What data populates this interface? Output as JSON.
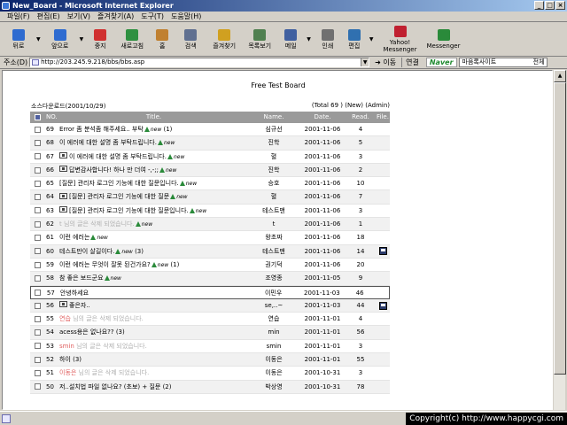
{
  "window": {
    "title": "New_Board - Microsoft Internet Explorer"
  },
  "menu": [
    "파일(F)",
    "편집(E)",
    "보기(V)",
    "즐겨찾기(A)",
    "도구(T)",
    "도움말(H)"
  ],
  "toolbar": [
    {
      "label": "뒤로",
      "icon": "back-arrow-icon",
      "color": "#2e6bd0",
      "drop": true
    },
    {
      "label": "앞으로",
      "icon": "forward-arrow-icon",
      "color": "#2e6bd0",
      "drop": true
    },
    {
      "label": "중지",
      "icon": "stop-icon",
      "color": "#d03030",
      "drop": false
    },
    {
      "label": "새로고침",
      "icon": "refresh-icon",
      "color": "#2e9040",
      "drop": false
    },
    {
      "label": "홈",
      "icon": "home-icon",
      "color": "#c08030",
      "drop": false
    },
    {
      "label": "검색",
      "icon": "search-icon",
      "color": "#607090",
      "drop": false
    },
    {
      "label": "즐겨찾기",
      "icon": "favorites-icon",
      "color": "#d0a020",
      "drop": false
    },
    {
      "label": "목록보기",
      "icon": "history-icon",
      "color": "#508050",
      "drop": false
    },
    {
      "label": "메일",
      "icon": "mail-icon",
      "color": "#4060a0",
      "drop": true
    },
    {
      "label": "인쇄",
      "icon": "print-icon",
      "color": "#707070",
      "drop": false
    },
    {
      "label": "편집",
      "icon": "edit-icon",
      "color": "#3070b0",
      "drop": true
    },
    {
      "label": "Yahoo! Messenger",
      "icon": "yahoo-messenger-icon",
      "color": "#c02030",
      "drop": false
    },
    {
      "label": "Messenger",
      "icon": "messenger-icon",
      "color": "#2a8a3a",
      "drop": false
    }
  ],
  "address": {
    "label": "주소(D)",
    "url": "http://203.245.9.218/bbs/bbs.asp",
    "go": "이동",
    "links": "연결",
    "naver": "Naver",
    "naver_text": "마음록사이트",
    "naver_side": "전체"
  },
  "board": {
    "title": "Free Test Board",
    "subtitle": "소스다운로드(2001/10/29)",
    "summary": "(Total 69 ) (New) (Admin)",
    "headers": {
      "no": "NO.",
      "title": "Title.",
      "name": "Name.",
      "date": "Date.",
      "read": "Read.",
      "file": "File."
    },
    "rows": [
      {
        "no": "69",
        "title": "Error 좀 분석좀 해주세요.. 부탁",
        "isnew": true,
        "count": "(1)",
        "name": "심규선",
        "date": "2001-11-06",
        "read": "4"
      },
      {
        "no": "68",
        "title": "이 에러에 대한 설명 좀 부탁드립니다.",
        "isnew": true,
        "name": "진학",
        "date": "2001-11-06",
        "read": "5"
      },
      {
        "no": "67",
        "title": "이 에러에 대한 설명 좀 부탁드립니다.",
        "reply": true,
        "isnew": true,
        "name": "혈",
        "date": "2001-11-06",
        "read": "3"
      },
      {
        "no": "66",
        "title": "답변감사합니다! 하나 만 더여 -,-;;",
        "reply": true,
        "isnew": true,
        "name": "진학",
        "date": "2001-11-06",
        "read": "2"
      },
      {
        "no": "65",
        "title": "[질문] 관리자 로그인 기능에 대한 질문입니다.",
        "isnew": true,
        "name": "승호",
        "date": "2001-11-06",
        "read": "10"
      },
      {
        "no": "64",
        "title": "[질문] 관리자 로그인 기능에 대한 질문",
        "reply": true,
        "isnew": true,
        "name": "혈",
        "date": "2001-11-06",
        "read": "7"
      },
      {
        "no": "63",
        "title": "[질문] 관리자 로그인 기능에 대한 질문입니다.",
        "reply": true,
        "isnew": true,
        "name": "테스트맨",
        "date": "2001-11-06",
        "read": "3"
      },
      {
        "no": "62",
        "title": "t 님의 글은 삭제 되었습니다.",
        "deleted": true,
        "isnew": true,
        "name": "t",
        "date": "2001-11-06",
        "read": "1"
      },
      {
        "no": "61",
        "title": "이런 에러는",
        "isnew": true,
        "name": "왕초짜",
        "date": "2001-11-06",
        "read": "18"
      },
      {
        "no": "60",
        "title": "테스트만이 살길이다.",
        "isnew": true,
        "count": "(3)",
        "name": "테스트맨",
        "date": "2001-11-06",
        "read": "14",
        "file": true
      },
      {
        "no": "59",
        "title": "이런 에러는 무엇이 잘못 된건가요?",
        "isnew": true,
        "count": "(1)",
        "name": "권기덕",
        "date": "2001-11-06",
        "read": "20"
      },
      {
        "no": "58",
        "title": "참 좋은 보드군요",
        "isnew": true,
        "name": "조영종",
        "date": "2001-11-05",
        "read": "9"
      },
      {
        "no": "57",
        "title": "안녕하세요",
        "name": "이민우",
        "date": "2001-11-03",
        "read": "46",
        "selected": true
      },
      {
        "no": "56",
        "title": "좋은자..",
        "reply": true,
        "name": "se,..~",
        "date": "2001-11-03",
        "read": "44",
        "file": true
      },
      {
        "no": "55",
        "title": "연습 님의 글은 삭제 되었습니다.",
        "deleted": true,
        "pinkname": "연습",
        "name": "연습",
        "date": "2001-11-01",
        "read": "4"
      },
      {
        "no": "54",
        "title": "acess용은 없나요?? (3)",
        "name": "min",
        "date": "2001-11-01",
        "read": "56"
      },
      {
        "no": "53",
        "title": "smin 님의 글은 삭제 되었습니다.",
        "deleted": true,
        "pinkname": "smin",
        "name": "smin",
        "date": "2001-11-01",
        "read": "3"
      },
      {
        "no": "52",
        "title": "하이 (3)",
        "name": "이동은",
        "date": "2001-11-01",
        "read": "55"
      },
      {
        "no": "51",
        "title": "이동은 님의 글은 삭제 되었습니다.",
        "deleted": true,
        "pinkname": "이동은",
        "name": "이동은",
        "date": "2001-10-31",
        "read": "3"
      },
      {
        "no": "50",
        "title": "저..설치법 파일 없나요? (초보) + 질문 (2)",
        "name": "박상영",
        "date": "2001-10-31",
        "read": "78"
      }
    ]
  },
  "status": {
    "copyright": "Copyright(c) http://www.happycgi.com"
  },
  "colors": {
    "title_bar": "#0a246a",
    "header_bg": "#9a9a9a",
    "new_icon": "#2a8a3a",
    "deleted_text": "#b0b0b0"
  }
}
